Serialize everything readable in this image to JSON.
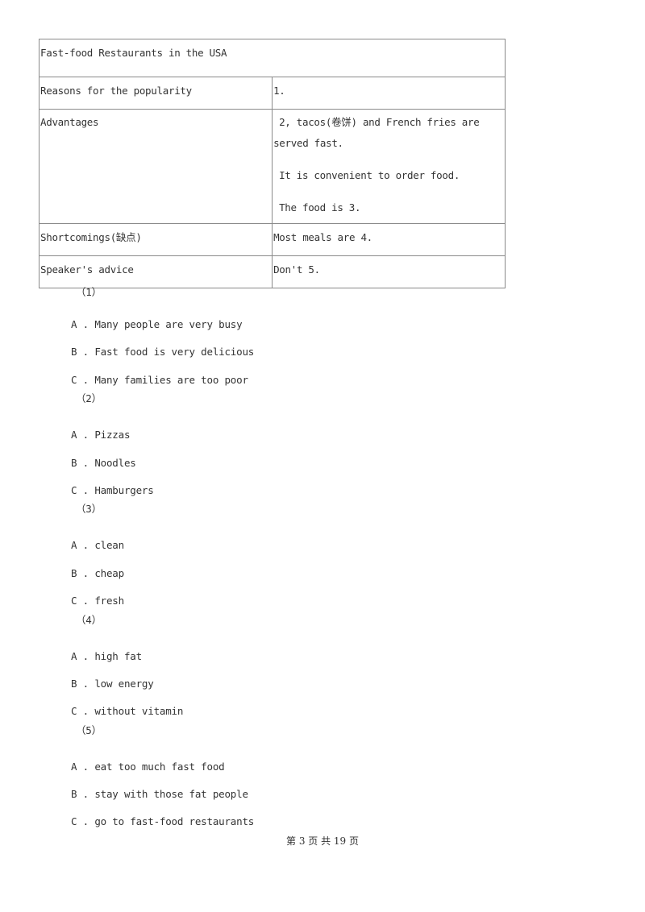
{
  "table": {
    "title": "Fast-food Restaurants in the USA",
    "rows": [
      {
        "label": "Reasons for the popularity",
        "value_lines": [
          "1."
        ]
      },
      {
        "label": "Advantages",
        "value_lines": [
          "2, tacos(卷饼) and French fries are",
          "served fast.",
          "It is convenient to order food.",
          "The food is 3."
        ]
      },
      {
        "label": "Shortcomings(缺点)",
        "value_lines": [
          "Most meals are 4."
        ]
      },
      {
        "label": "Speaker's advice",
        "value_lines": [
          "Don't 5."
        ]
      }
    ]
  },
  "questions": [
    {
      "number": "（1）",
      "options": [
        {
          "letter": "A",
          "text": "Many people are very busy"
        },
        {
          "letter": "B",
          "text": "Fast food is very delicious"
        },
        {
          "letter": "C",
          "text": "Many families are too poor"
        }
      ]
    },
    {
      "number": "（2）",
      "options": [
        {
          "letter": "A",
          "text": "Pizzas"
        },
        {
          "letter": "B",
          "text": "Noodles"
        },
        {
          "letter": "C",
          "text": "Hamburgers"
        }
      ]
    },
    {
      "number": "（3）",
      "options": [
        {
          "letter": "A",
          "text": "clean"
        },
        {
          "letter": "B",
          "text": "cheap"
        },
        {
          "letter": "C",
          "text": "fresh"
        }
      ]
    },
    {
      "number": "（4）",
      "options": [
        {
          "letter": "A",
          "text": "high fat"
        },
        {
          "letter": "B",
          "text": "low energy"
        },
        {
          "letter": "C",
          "text": "without vitamin"
        }
      ]
    },
    {
      "number": "（5）",
      "options": [
        {
          "letter": "A",
          "text": "eat too much fast food"
        },
        {
          "letter": "B",
          "text": "stay with those fat people"
        },
        {
          "letter": "C",
          "text": "go to fast-food restaurants"
        }
      ]
    }
  ],
  "option_separator": " . ",
  "footer": {
    "text": "第 3 页 共 19 页"
  }
}
